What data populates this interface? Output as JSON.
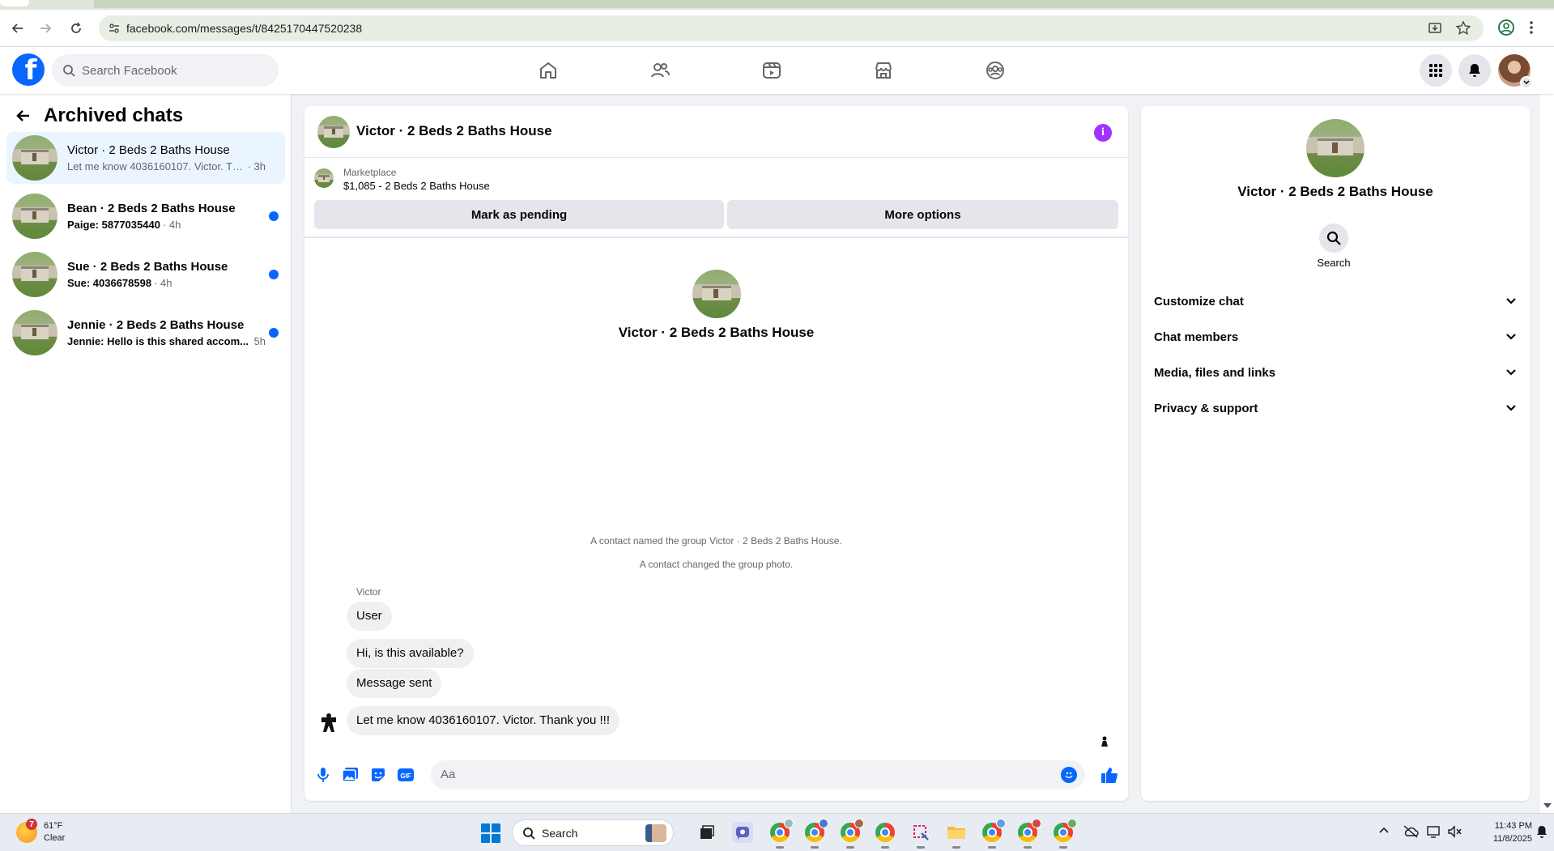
{
  "browser": {
    "url": "facebook.com/messages/t/8425170447520238"
  },
  "header": {
    "search_placeholder": "Search Facebook",
    "nav_icons": [
      "home-icon",
      "friends-icon",
      "video-icon",
      "marketplace-icon",
      "groups-icon"
    ],
    "accent": "#0866ff"
  },
  "sidebar": {
    "title": "Archived chats",
    "chats": [
      {
        "name": "Victor · 2 Beds 2 Baths House",
        "preview": "Let me know 4036160107. Victor. Tha...",
        "time": "· 3h",
        "unread": false,
        "active": true
      },
      {
        "name": "Bean · 2 Beds 2 Baths House",
        "preview": "Paige: 5877035440",
        "time": "· 4h",
        "unread": true,
        "active": false
      },
      {
        "name": "Sue · 2 Beds 2 Baths House",
        "preview": "Sue: 4036678598",
        "time": "· 4h",
        "unread": true,
        "active": false
      },
      {
        "name": "Jennie · 2 Beds 2 Baths House",
        "preview": "Jennie: Hello is this shared accom...",
        "time": "5h",
        "unread": true,
        "active": false
      }
    ]
  },
  "conversation": {
    "title": "Victor · 2 Beds 2 Baths House",
    "marketplace_label": "Marketplace",
    "listing": "$1,085 - 2 Beds 2 Baths House",
    "mark_pending": "Mark as pending",
    "more_options": "More options",
    "center_name": "Victor · 2 Beds 2 Baths House",
    "system_messages": [
      "A contact named the group Victor · 2 Beds 2 Baths House.",
      "A contact changed the group photo."
    ],
    "sender": "Victor",
    "messages": [
      "User",
      "Hi, is this available?",
      "Message sent",
      "Let me know 4036160107.   Victor.  Thank you !!!"
    ],
    "composer_placeholder": "Aa"
  },
  "details": {
    "name": "Victor · 2 Beds 2 Baths House",
    "search_label": "Search",
    "sections": [
      "Customize chat",
      "Chat members",
      "Media, files and links",
      "Privacy & support"
    ]
  },
  "taskbar": {
    "temp": "61°F",
    "condition": "Clear",
    "weather_badge": "7",
    "search_label": "Search",
    "time": "11:43 PM",
    "date": "11/8/2025"
  }
}
